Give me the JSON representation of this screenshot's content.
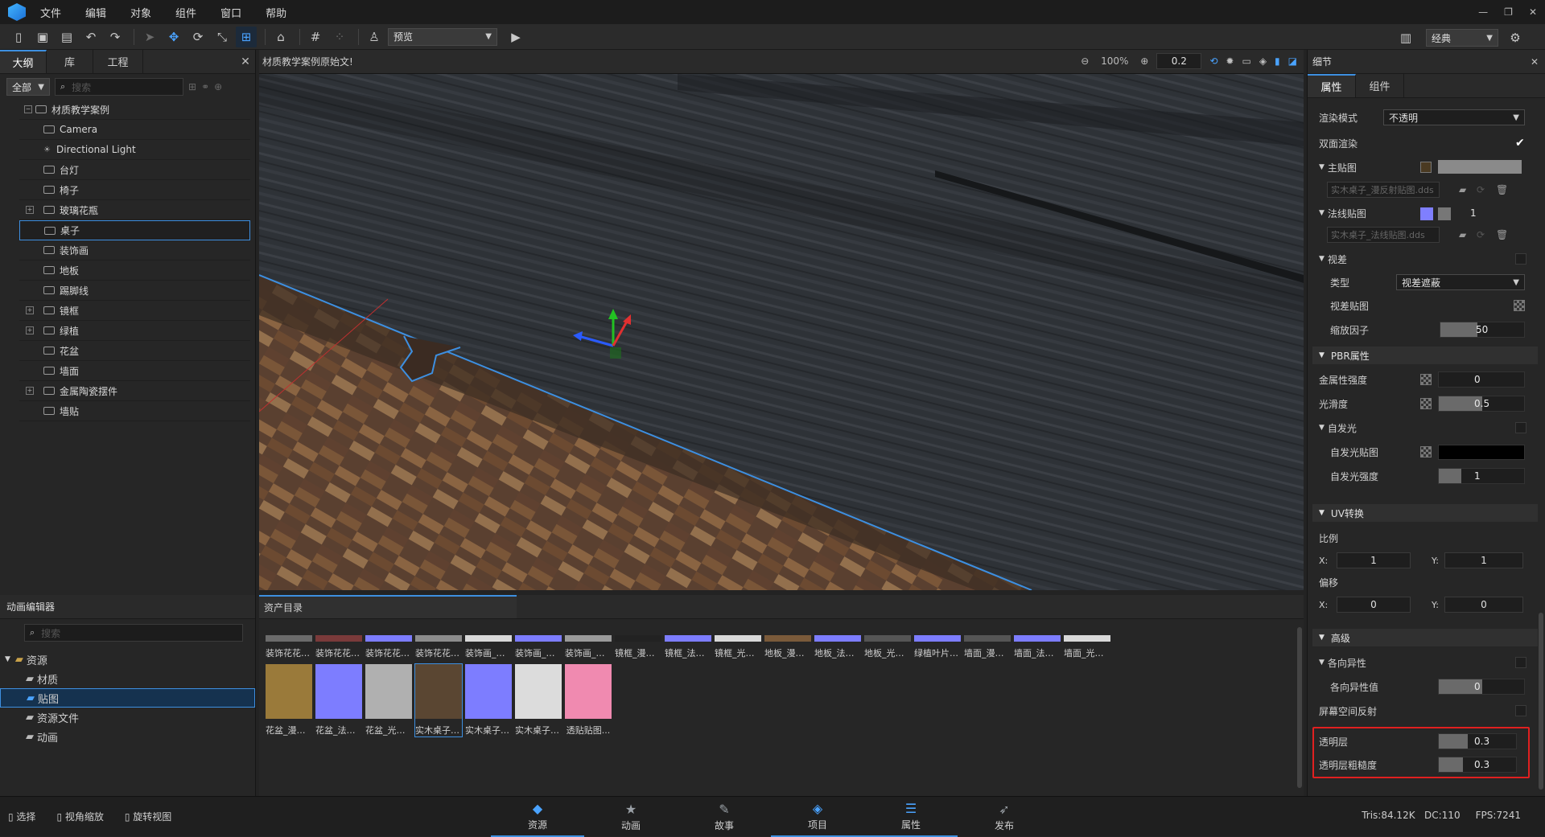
{
  "menu": [
    "文件",
    "编辑",
    "对象",
    "组件",
    "窗口",
    "帮助"
  ],
  "toolbar": {
    "preview_mode": "预览",
    "layout": "经典"
  },
  "outline": {
    "tabs": [
      "大纲",
      "库",
      "工程"
    ],
    "filter": "全部",
    "search_placeholder": "搜索",
    "root": "材质教学案例",
    "items": [
      {
        "label": "Camera",
        "icon": "camera-icon"
      },
      {
        "label": "Directional Light",
        "icon": "light-icon"
      },
      {
        "label": "台灯",
        "icon": "object-icon"
      },
      {
        "label": "椅子",
        "icon": "object-icon"
      },
      {
        "label": "玻璃花瓶",
        "icon": "object-icon",
        "expandable": true
      },
      {
        "label": "桌子",
        "icon": "object-icon",
        "selected": true
      },
      {
        "label": "装饰画",
        "icon": "object-icon"
      },
      {
        "label": "地板",
        "icon": "object-icon"
      },
      {
        "label": "踢脚线",
        "icon": "object-icon"
      },
      {
        "label": "镜框",
        "icon": "object-icon",
        "expandable": true
      },
      {
        "label": "绿植",
        "icon": "object-icon",
        "expandable": true
      },
      {
        "label": "花盆",
        "icon": "object-icon"
      },
      {
        "label": "墙面",
        "icon": "object-icon"
      },
      {
        "label": "金属陶瓷摆件",
        "icon": "object-icon",
        "expandable": true
      },
      {
        "label": "墙贴",
        "icon": "object-icon"
      }
    ]
  },
  "viewport": {
    "title": "材质教学案例原始文!",
    "zoom": "100%",
    "step": "0.2"
  },
  "details": {
    "title": "细节",
    "tabs": [
      "属性",
      "组件"
    ],
    "render_mode_label": "渲染模式",
    "render_mode": "不透明",
    "double_sided": "双面渲染",
    "main_map": "主贴图",
    "main_map_file": "实木桌子_漫反射贴图.dds",
    "normal_map": "法线贴图",
    "normal_value": "1",
    "normal_map_file": "实木桌子_法线贴图.dds",
    "parallax": "视差",
    "type_label": "类型",
    "type_value": "视差遮蔽",
    "parallax_map": "视差贴图",
    "scale_factor": "缩放因子",
    "scale_value": "50",
    "pbr": "PBR属性",
    "metal_label": "金属性强度",
    "metal_value": "0",
    "smooth_label": "光滑度",
    "smooth_value": "0.5",
    "emissive": "自发光",
    "emissive_map": "自发光贴图",
    "emissive_strength": "自发光强度",
    "emissive_value": "1",
    "uv": "UV转换",
    "ratio": "比例",
    "offset": "偏移",
    "x": "X:",
    "y": "Y:",
    "ratio_x": "1",
    "ratio_y": "1",
    "offset_x": "0",
    "offset_y": "0",
    "advanced": "高级",
    "aniso": "各向异性",
    "aniso_value_label": "各向异性值",
    "aniso_value": "0",
    "ssr": "屏幕空间反射",
    "clearcoat": "透明层",
    "clearcoat_value": "0.3",
    "clearcoat_rough": "透明层粗糙度",
    "clearcoat_rough_value": "0.3"
  },
  "anim": {
    "title": "动画编辑器",
    "search_placeholder": "搜索",
    "tree": [
      "资源",
      "材质",
      "贴图",
      "资源文件",
      "动画"
    ]
  },
  "assets": {
    "tab": "资产目录",
    "row1": [
      "装饰花花茎...",
      "装饰花花球...",
      "装饰花花球...",
      "装饰花花球...",
      "装饰画_漫...",
      "装饰画_法...",
      "装饰画_光...",
      "镜框_漫反...",
      "镜框_法线...",
      "镜框_光滑...",
      "地板_漫反...",
      "地板_法线...",
      "地板_光滑...",
      "绿植叶片_...",
      "墙面_漫反...",
      "墙面_法线...",
      "墙面_光滑..."
    ],
    "row2": [
      "花盆_漫反...",
      "花盆_法线...",
      "花盆_光滑...",
      "实木桌子_...",
      "实木桌子_...",
      "实木桌子_...",
      "透贴贴图..."
    ]
  },
  "status": {
    "left": [
      "选择",
      "视角缩放",
      "旋转视图"
    ],
    "tabs": [
      "资源",
      "动画",
      "故事",
      "项目",
      "属性",
      "发布"
    ],
    "stats": "Tris:84.12K   DC:110     FPS:7241"
  }
}
